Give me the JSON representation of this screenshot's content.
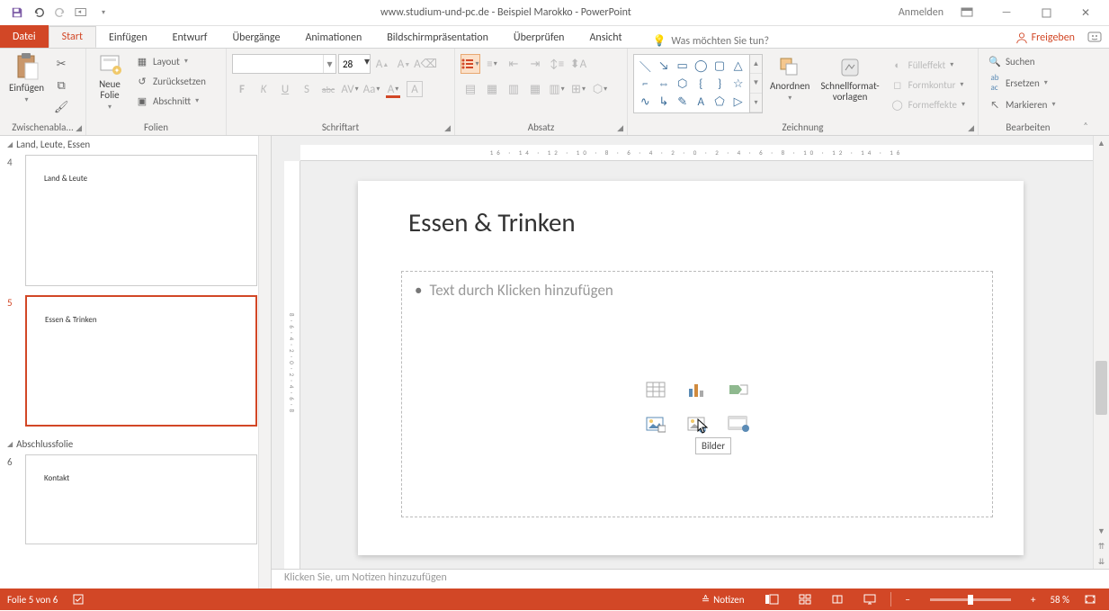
{
  "app": {
    "title": "www.studium-und-pc.de - Beispiel Marokko  -  PowerPoint",
    "signin": "Anmelden"
  },
  "ribbon_tabs": {
    "file": "Datei",
    "home": "Start",
    "insert": "Einfügen",
    "design": "Entwurf",
    "transitions": "Übergänge",
    "animations": "Animationen",
    "slideshow": "Bildschirmpräsentation",
    "review": "Überprüfen",
    "view": "Ansicht",
    "tellme_placeholder": "Was möchten Sie tun?",
    "share": "Freigeben"
  },
  "ribbon": {
    "clipboard": {
      "label": "Zwischenabla...",
      "paste": "Einfügen"
    },
    "slides": {
      "label": "Folien",
      "new": "Neue\nFolie",
      "layout": "Layout",
      "reset": "Zurücksetzen",
      "section": "Abschnitt"
    },
    "font": {
      "label": "Schriftart",
      "size": "28",
      "bold": "F",
      "italic": "K",
      "underline": "U",
      "strike": "abc"
    },
    "paragraph": {
      "label": "Absatz"
    },
    "drawing": {
      "label": "Zeichnung",
      "arrange": "Anordnen",
      "quickstyles": "Schnellformat-\nvorlagen",
      "fill": "Fülleffekt",
      "outline": "Formkontur",
      "effects": "Formeffekte"
    },
    "editing": {
      "label": "Bearbeiten",
      "find": "Suchen",
      "replace": "Ersetzen",
      "select": "Markieren"
    }
  },
  "panel": {
    "section1": "Land, Leute, Essen",
    "section2": "Abschlussfolie",
    "slide4_num": "4",
    "slide4_title": "Land & Leute",
    "slide5_num": "5",
    "slide5_title": "Essen & Trinken",
    "slide6_num": "6",
    "slide6_title": "Kontakt"
  },
  "slide": {
    "title": "Essen & Trinken",
    "placeholder": "Text durch Klicken hinzufügen",
    "tooltip": "Bilder"
  },
  "notes_placeholder": "Klicken Sie, um Notizen hinzuzufügen",
  "statusbar": {
    "slide_info": "Folie 5 von 6",
    "notes": "Notizen",
    "zoom": "58 %"
  },
  "ruler_nums": "16 · 14 · 12 · 10 · 8 · 6 · 4 · 2 · 0 · 2 · 4 · 6 · 8 · 10 · 12 · 14 · 16"
}
